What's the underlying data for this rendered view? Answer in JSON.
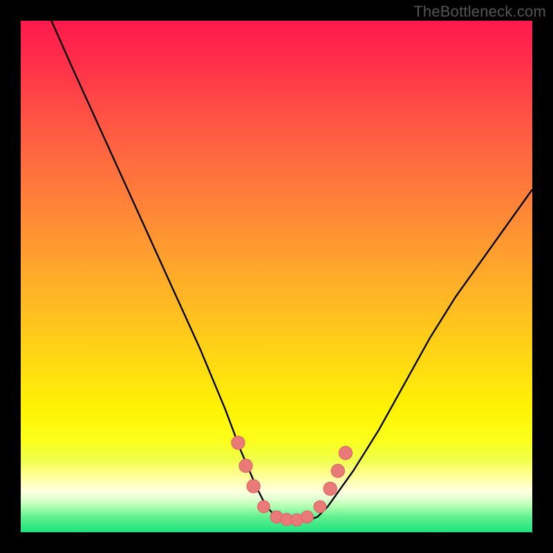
{
  "watermark": "TheBottleneck.com",
  "colors": {
    "background": "#000000",
    "curve": "#000000",
    "marker_fill": "#e97a78",
    "marker_stroke": "#d86765",
    "gradient_top": "#ff1a4c",
    "gradient_bottom": "#1fe27e"
  },
  "chart_data": {
    "type": "line",
    "title": "",
    "xlabel": "",
    "ylabel": "",
    "xlim": [
      0,
      100
    ],
    "ylim": [
      0,
      100
    ],
    "grid": false,
    "legend": false,
    "series": [
      {
        "name": "curve",
        "x": [
          6,
          10,
          15,
          20,
          25,
          30,
          35,
          40,
          43,
          46,
          48,
          50,
          52,
          54,
          56,
          58,
          60,
          65,
          70,
          75,
          80,
          85,
          90,
          95,
          100
        ],
        "y": [
          100,
          91,
          80,
          69,
          58,
          47,
          36,
          24,
          16,
          9,
          5,
          3,
          2.3,
          2.2,
          2.3,
          3,
          5,
          12,
          20,
          29,
          38,
          46,
          53,
          60,
          67
        ]
      }
    ],
    "markers": [
      {
        "x": 42.5,
        "y": 17.5,
        "r": 1.3
      },
      {
        "x": 44.0,
        "y": 13.0,
        "r": 1.3
      },
      {
        "x": 45.5,
        "y": 9.0,
        "r": 1.3
      },
      {
        "x": 47.5,
        "y": 5.0,
        "r": 1.2
      },
      {
        "x": 50.0,
        "y": 3.0,
        "r": 1.2
      },
      {
        "x": 52.0,
        "y": 2.5,
        "r": 1.2
      },
      {
        "x": 54.0,
        "y": 2.4,
        "r": 1.2
      },
      {
        "x": 56.0,
        "y": 3.0,
        "r": 1.2
      },
      {
        "x": 58.5,
        "y": 5.0,
        "r": 1.2
      },
      {
        "x": 60.5,
        "y": 8.5,
        "r": 1.3
      },
      {
        "x": 62.0,
        "y": 12.0,
        "r": 1.3
      },
      {
        "x": 63.5,
        "y": 15.5,
        "r": 1.3
      }
    ]
  }
}
